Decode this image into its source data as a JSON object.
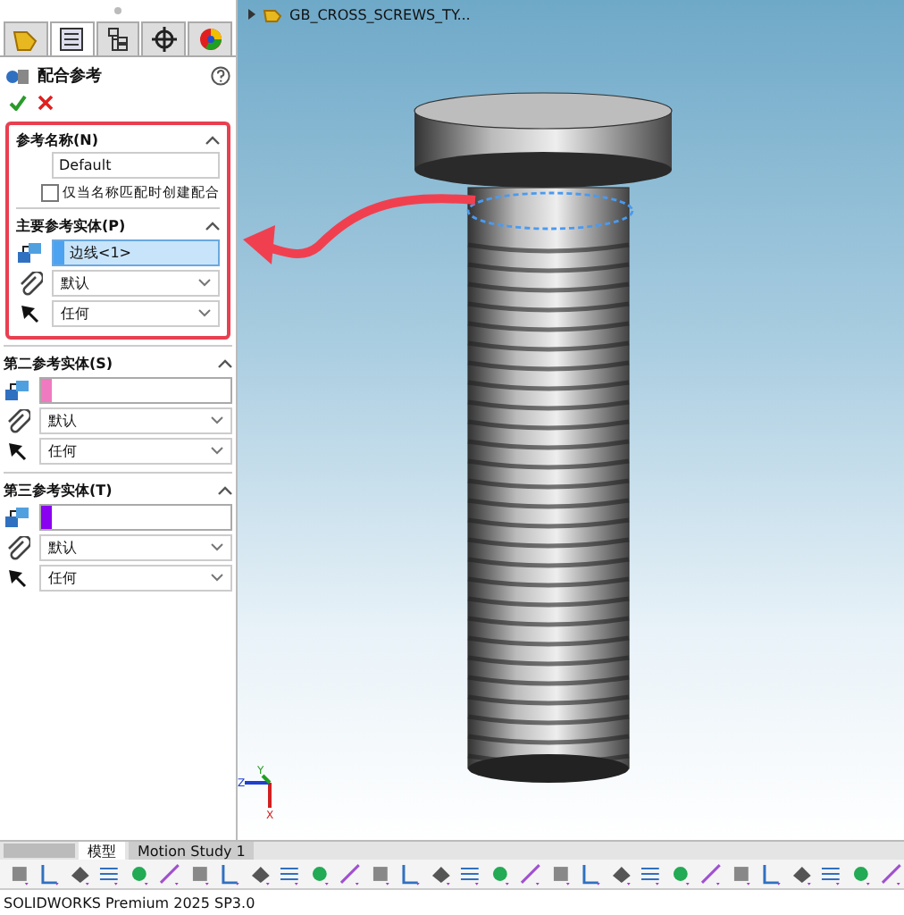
{
  "panel": {
    "tabs": [
      {
        "kind": "feature",
        "selected": false
      },
      {
        "kind": "property",
        "selected": true
      },
      {
        "kind": "config",
        "selected": false
      },
      {
        "kind": "target",
        "selected": false
      },
      {
        "kind": "appearance",
        "selected": false
      }
    ],
    "title": "配合参考",
    "callout": true,
    "name_section": {
      "title": "参考名称(N)",
      "value": "Default",
      "checkbox_label": "仅当名称匹配时创建配合",
      "checked": false
    },
    "entity_sections": [
      {
        "title": "主要参考实体(P)",
        "value": "边线<1>",
        "color": "#4da3f0",
        "active": true,
        "alignment": "默认",
        "constraint": "任何"
      },
      {
        "title": "第二参考实体(S)",
        "color": "#f07ac0",
        "active": false,
        "alignment": "默认",
        "constraint": "任何"
      },
      {
        "title": "第三参考实体(T)",
        "color": "#8a00f0",
        "active": false,
        "alignment": "默认",
        "constraint": "任何"
      }
    ]
  },
  "viewport": {
    "tree_item": "GB_CROSS_SCREWS_TY...",
    "triad": [
      "Y",
      "Z",
      "X"
    ]
  },
  "bottom_tabs": [
    {
      "label": "模型",
      "selected": true
    },
    {
      "label": "Motion Study 1",
      "selected": false
    }
  ],
  "status_bar": "SOLIDWORKS Premium 2025 SP3.0"
}
